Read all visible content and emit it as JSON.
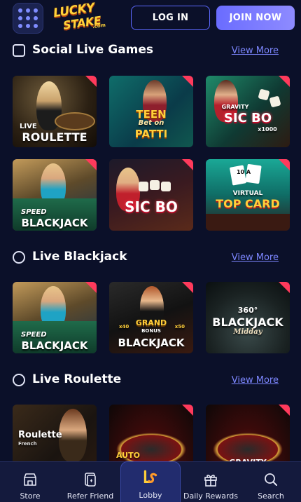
{
  "header": {
    "logo_top": "LUCKY",
    "logo_bottom": "STAKE",
    "logo_suffix": ".com",
    "login_label": "LOG IN",
    "join_label": "JOIN NOW"
  },
  "sections": [
    {
      "title": "Social Live Games",
      "view_more": "View More",
      "icon": "cards-icon",
      "games": [
        {
          "label_a": "LIVE",
          "label_b": "ROULETTE"
        },
        {
          "label_a": "TEEN",
          "label_b": "PATTI",
          "label_c": "Bet on"
        },
        {
          "label_a": "GRAVITY",
          "label_b": "SIC BO",
          "label_c": "x1000"
        },
        {
          "label_a": "SPEED",
          "label_b": "BLACKJACK"
        },
        {
          "label_a": "",
          "label_b": "SIC BO"
        },
        {
          "label_a": "VIRTUAL",
          "label_b": "TOP CARD",
          "label_c": "10 A"
        }
      ]
    },
    {
      "title": "Live Blackjack",
      "view_more": "View More",
      "icon": "spade-icon",
      "games": [
        {
          "label_a": "SPEED",
          "label_b": "BLACKJACK"
        },
        {
          "label_a": "GRAND",
          "label_b": "BLACKJACK",
          "label_c": "BONUS",
          "label_d": "x40",
          "label_e": "x50"
        },
        {
          "label_a": "360°",
          "label_b": "BLACKJACK",
          "label_c": "Midday"
        }
      ]
    },
    {
      "title": "Live Roulette",
      "view_more": "View More",
      "icon": "plus-circle-icon",
      "games": [
        {
          "label_a": "Roulette",
          "label_b": "French"
        },
        {
          "label_a": "AUTO",
          "label_b": ""
        },
        {
          "label_a": "GRAVITY",
          "label_b": ""
        }
      ]
    }
  ],
  "bottom_nav": [
    {
      "label": "Store",
      "icon": "store-icon"
    },
    {
      "label": "Refer Friend",
      "icon": "refer-friend-icon"
    },
    {
      "label": "Lobby",
      "icon": "lobby-logo-icon",
      "active": true
    },
    {
      "label": "Daily Rewards",
      "icon": "gift-icon"
    },
    {
      "label": "Search",
      "icon": "search-icon"
    }
  ],
  "colors": {
    "background": "#0b1029",
    "accent": "#6a6cff",
    "link": "#7d87ff",
    "nav_bg": "#141a3d"
  }
}
